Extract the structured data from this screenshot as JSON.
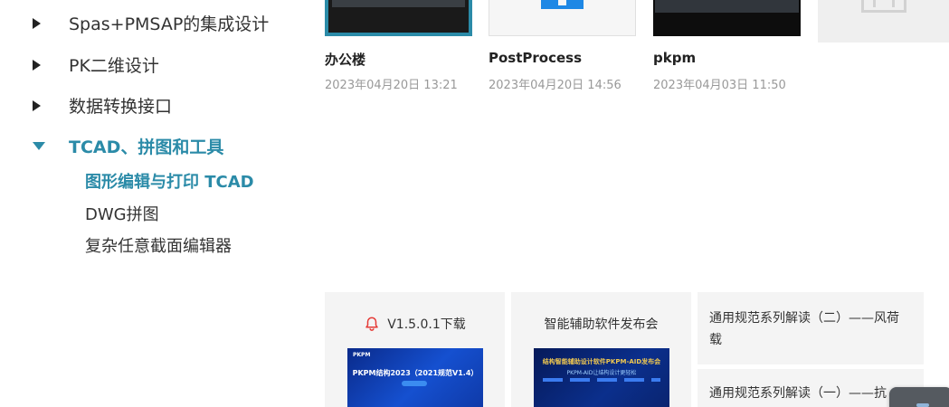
{
  "sidebar": {
    "items": [
      {
        "label": "Spas+PMSAP的集成设计",
        "expanded": false
      },
      {
        "label": "PK二维设计",
        "expanded": false
      },
      {
        "label": "数据转换接口",
        "expanded": false
      },
      {
        "label": "TCAD、拼图和工具",
        "expanded": true,
        "children": [
          {
            "label": "图形编辑与打印 TCAD",
            "active": true
          },
          {
            "label": "DWG拼图",
            "active": false
          },
          {
            "label": "复杂任意截面编辑器",
            "active": false
          }
        ]
      }
    ]
  },
  "projects": [
    {
      "title": "办公楼",
      "date": "2023年04月20日 13:21"
    },
    {
      "title": "PostProcess",
      "date": "2023年04月20日 14:56"
    },
    {
      "title": "pkpm",
      "date": "2023年04月03日 11:50"
    }
  ],
  "news": {
    "download": {
      "icon": "bell-icon",
      "label": "V1.5.0.1下载",
      "banner_logo": "PKPM",
      "banner_text": "PKPM结构2023（2021规范V1.4）"
    },
    "launch": {
      "label": "智能辅助软件发布会",
      "banner_text": "结构智能辅助设计软件PKPM-AID发布会",
      "banner_sub": "PKPM-AID让结构设计更轻松"
    },
    "articles": [
      {
        "title": "通用规范系列解读（二）——风荷载"
      },
      {
        "title": "通用规范系列解读（一）——抗"
      }
    ]
  },
  "colors": {
    "accent": "#2b8ba8",
    "bell": "#e53935"
  }
}
